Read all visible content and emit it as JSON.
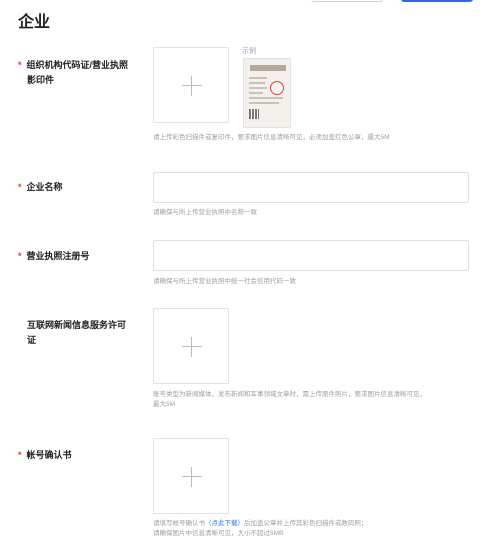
{
  "page": {
    "section_title": "企业"
  },
  "fields": {
    "license_copy": {
      "label": "组织机构代码证/营业执照影印件",
      "label_line1": "组织机构代码证/营业执照",
      "label_line2": "影印件",
      "required": true,
      "example_label": "示例",
      "example_doc_title": "营业执照",
      "hint": "请上传彩色扫描件或复印件，要求图片信息清晰可见，必须加盖红色公章，最大5M"
    },
    "company_name": {
      "label": "企业名称",
      "required": true,
      "value": "",
      "hint": "请确保与所上传营业执照中名称一致"
    },
    "license_number": {
      "label": "营业执照注册号",
      "required": true,
      "value": "",
      "hint": "请确保与所上传营业执照中统一社会信用代码一致"
    },
    "news_license": {
      "label": "互联网新闻信息服务许可证",
      "label_line1": "互联网新闻信息服务许可",
      "label_line2": "证",
      "required": false,
      "hint_line1": "账号类型为新闻媒体，发布新闻和军事领域文章时，需上传原件照片，要求图片信息清晰可见，",
      "hint_line2": "最大5M"
    },
    "account_confirmation": {
      "label": "帐号确认书",
      "required": true,
      "hint_pre": "请填写帐号确认书",
      "hint_link": "（点此下载）",
      "hint_post": "后加盖公章并上传其彩色扫描件或数码照；",
      "hint_line2": "请确保图片中信息清晰可见，大小不超过5MB"
    }
  },
  "icons": {
    "upload": "plus-icon"
  },
  "colors": {
    "required_star": "#e03c31",
    "link": "#2f6bdb",
    "primary_button": "#2f6bdb",
    "hint_text": "#9aa0a8"
  }
}
